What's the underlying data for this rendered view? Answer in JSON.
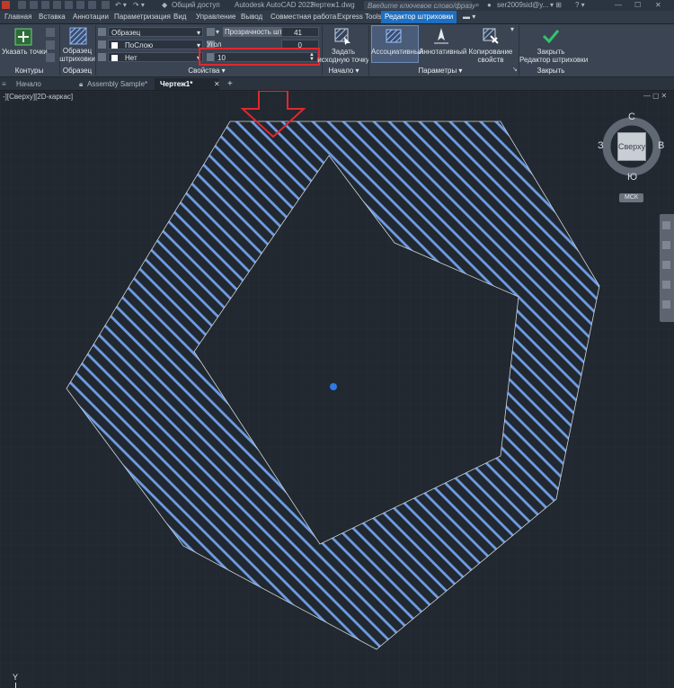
{
  "titlebar": {
    "share_label": "Общий доступ",
    "app_title": "Autodesk AutoCAD 2022",
    "drawing_name": "Чертеж1.dwg",
    "search_placeholder": "Введите ключевое слово/фразу",
    "user": "ser2009sid@y..."
  },
  "menubar": {
    "items": [
      "Главная",
      "Вставка",
      "Аннотации",
      "Параметризация",
      "Вид",
      "Управление",
      "Вывод",
      "Совместная работа",
      "Express Tools",
      "Редактор штриховки"
    ],
    "active": "Редактор штриховки"
  },
  "ribbon": {
    "contours": {
      "pick_points": "Указать точки",
      "title": "Контуры"
    },
    "pattern": {
      "button_line1": "Образец",
      "button_line2": "штриховки",
      "title": "Образец"
    },
    "properties": {
      "type_value": "Образец",
      "color_value": "ПоСлою",
      "bg_value": "Нет",
      "transparency_label": "Прозрачность шт...",
      "transparency_value": "41",
      "angle_label": "Угол",
      "angle_value": "0",
      "scale_value": "10",
      "title": "Свойства ▾"
    },
    "origin": {
      "line1": "Задать",
      "line2": "исходную точку",
      "title": "Начало ▾"
    },
    "params": {
      "associative": "Ассоциативный",
      "annotative": "Аннотативный",
      "copy_line1": "Копирование",
      "copy_line2": "свойств",
      "title": "Параметры ▾"
    },
    "close": {
      "line1": "Закрыть",
      "line2": "Редактор штриховки",
      "title": "Закрыть"
    }
  },
  "filetabs": {
    "items": [
      "Начало",
      "Assembly Sample*",
      "Чертеж1*"
    ],
    "active": "Чертеж1*",
    "add": "+"
  },
  "viewport": {
    "label": "-][Сверху][2D-каркас]"
  },
  "viewcube": {
    "north": "С",
    "south": "Ю",
    "east": "В",
    "west": "З",
    "face": "Сверху",
    "wcs": "МСК"
  },
  "ucs": {
    "y_label": "Y"
  },
  "colors": {
    "accent": "#1d6fc2",
    "hatch": "#6e9de6",
    "highlight": "#e0282e",
    "canvas": "#212830"
  }
}
